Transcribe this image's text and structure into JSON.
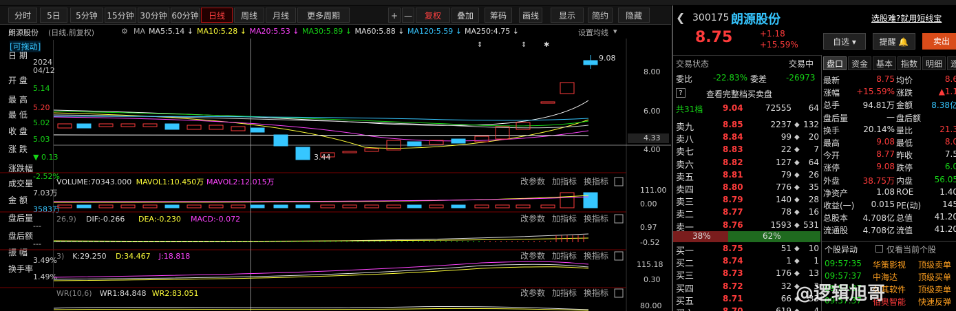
{
  "toolbar": {
    "buttons": [
      "分时",
      "5日",
      "5分钟",
      "15分钟",
      "30分钟",
      "60分钟",
      "日线",
      "周线",
      "月线",
      "更多周期",
      "+",
      "—",
      "复权",
      "叠加",
      "筹码",
      "画线",
      "显示",
      "简约",
      "隐藏"
    ],
    "active": "日线"
  },
  "chart_head": {
    "stock": "朗源股份",
    "mode": "(日线,前复权)",
    "ma": [
      {
        "t": "MA5:5.14",
        "c": "#e0e0e0"
      },
      {
        "t": "MA10:5.28",
        "c": "#ffff3a"
      },
      {
        "t": "MA20:5.53",
        "c": "#ff44ff"
      },
      {
        "t": "MA30:5.89",
        "c": "#16d416"
      },
      {
        "t": "MA60:5.88",
        "c": "#e0e0e0"
      },
      {
        "t": "MA120:5.59",
        "c": "#36c6ff"
      },
      {
        "t": "MA250:4.75",
        "c": "#e0e0e0"
      }
    ],
    "set_label": "设置均线"
  },
  "info": {
    "drag": "[可拖动]",
    "rows": [
      {
        "k": "日  期",
        "v": "2024",
        "v2": "04/12",
        "c": "#ccc"
      },
      {
        "k": "开  盘",
        "v": "5.14",
        "c": "#16d416"
      },
      {
        "k": "最  高",
        "v": "5.20",
        "c": "#ff3b3b"
      },
      {
        "k": "最  低",
        "v": "5.02",
        "c": "#16d416"
      },
      {
        "k": "收  盘",
        "v": "5.03",
        "c": "#16d416"
      },
      {
        "k": "涨  跌",
        "v": "▼ 0.13",
        "c": "#16d416"
      },
      {
        "k": "涨跌幅",
        "v": "-2.52%",
        "c": "#16d416"
      },
      {
        "k": "成交量",
        "v": "7.03万",
        "c": "#ccc"
      },
      {
        "k": "金  额",
        "v": "3583万",
        "c": "#36c6ff"
      },
      {
        "k": "盘后量",
        "v": "---",
        "c": "#ccc"
      },
      {
        "k": "盘后额",
        "v": "---",
        "c": "#ccc"
      },
      {
        "k": "振  幅",
        "v": "3.49%",
        "c": "#ccc"
      },
      {
        "k": "换手率",
        "v": "1.49%",
        "c": "#ccc"
      }
    ]
  },
  "price_axis": [
    "8.00",
    "6.00",
    "4.33",
    "4.00"
  ],
  "markers": {
    "high": "9.08",
    "low": "3.44"
  },
  "volume": {
    "label": "VOLUME:70343.000",
    "mavol1": "MAVOL1:10.450万",
    "mavol2": "MAVOL2:12.015万",
    "axis": [
      "111.00",
      "0.00"
    ]
  },
  "macd": {
    "prefix": "26,9)",
    "dif": "DIF:-0.266",
    "dea": "DEA:-0.230",
    "macd": "MACD:-0.072",
    "axis": [
      "0.97",
      "-0.52"
    ]
  },
  "kdj": {
    "prefix": "3)",
    "k": "K:29.250",
    "d": "D:34.467",
    "j": "J:18.818",
    "axis": [
      "115.18",
      "0.30"
    ]
  },
  "wr": {
    "prefix": "WR(10,6)",
    "wr1": "WR1:84.848",
    "wr2": "WR2:83.051",
    "axis": [
      "80.00"
    ]
  },
  "sub_tools": [
    "改参数",
    "加指标",
    "换指标"
  ],
  "right": {
    "code": "300175",
    "name": "朗源股份",
    "promo": "选股难?就用短线宝",
    "price": "8.75",
    "change": "+1.18",
    "pct": "+15.59%",
    "btn_fav": "自选",
    "btn_alert": "提醒",
    "btn_sell": "卖出",
    "status_label": "交易状态",
    "status_value": "交易中",
    "weibi_label": "委比",
    "weibi": "-22.83%",
    "weicha_label": "委差",
    "weicha": "-26973",
    "full_book": "查看完整档买卖盘",
    "total_label": "共31档",
    "total_price": "9.04",
    "total_vol": "72555",
    "total_cnt": "64",
    "asks": [
      {
        "l": "卖九",
        "p": "8.85",
        "v": "2237",
        "c": "132"
      },
      {
        "l": "卖八",
        "p": "8.84",
        "v": "99",
        "c": "20"
      },
      {
        "l": "卖七",
        "p": "8.83",
        "v": "22",
        "c": "7"
      },
      {
        "l": "卖六",
        "p": "8.82",
        "v": "127",
        "c": "64"
      },
      {
        "l": "卖五",
        "p": "8.81",
        "v": "79",
        "c": "26"
      },
      {
        "l": "卖四",
        "p": "8.80",
        "v": "776",
        "c": "35"
      },
      {
        "l": "卖三",
        "p": "8.79",
        "v": "140",
        "c": "28"
      },
      {
        "l": "卖二",
        "p": "8.77",
        "v": "78",
        "c": "16"
      },
      {
        "l": "卖一",
        "p": "8.76",
        "v": "1593",
        "c": "531"
      }
    ],
    "ratio_left": "38%",
    "ratio_right": "62%",
    "bids": [
      {
        "l": "买一",
        "p": "8.75",
        "v": "51",
        "c": "10"
      },
      {
        "l": "买二",
        "p": "8.74",
        "v": "1",
        "c": "1"
      },
      {
        "l": "买三",
        "p": "8.73",
        "v": "176",
        "c": "13"
      },
      {
        "l": "买四",
        "p": "8.72",
        "v": "32",
        "c": "3"
      },
      {
        "l": "买五",
        "p": "8.71",
        "v": "66",
        "c": "33"
      },
      {
        "l": "买六",
        "p": "8.70",
        "v": "619",
        "c": "4"
      }
    ],
    "tabs": [
      "盘口",
      "资金",
      "基本",
      "指数",
      "明细",
      "逐笔"
    ],
    "quote": [
      {
        "l": "最新",
        "v": "8.75",
        "vc": "#ff3b3b",
        "l2": "均价",
        "v2": "8.6",
        "v2c": "#ff3b3b"
      },
      {
        "l": "涨幅",
        "v": "+15.59%",
        "vc": "#ff3b3b",
        "l2": "涨跌",
        "v2": "▲1.1",
        "v2c": "#ff3b3b"
      },
      {
        "l": "总手",
        "v": "94.81万",
        "vc": "#e0e0e0",
        "l2": "金额",
        "v2": "8.38亿",
        "v2c": "#36c6ff"
      },
      {
        "l": "盘后量",
        "v": "—",
        "vc": "#e0e0e0",
        "l2": "盘后额",
        "v2": "",
        "v2c": "#e0e0e0"
      },
      {
        "l": "换手",
        "v": "20.14%",
        "vc": "#e0e0e0",
        "l2": "量比",
        "v2": "21.3",
        "v2c": "#ff3b3b"
      },
      {
        "l": "最高",
        "v": "9.08",
        "vc": "#ff3b3b",
        "l2": "最低",
        "v2": "8.0",
        "v2c": "#ff3b3b"
      },
      {
        "l": "今开",
        "v": "8.77",
        "vc": "#ff3b3b",
        "l2": "昨收",
        "v2": "7.5",
        "v2c": "#e0e0e0"
      },
      {
        "l": "涨停",
        "v": "9.08",
        "vc": "#ff3b3b",
        "l2": "跌停",
        "v2": "6.0",
        "v2c": "#16d416"
      },
      {
        "l": "外盘",
        "v": "38.75万",
        "vc": "#ff3b3b",
        "l2": "内盘",
        "v2": "56.05",
        "v2c": "#16d416"
      },
      {
        "l": "净资产",
        "v": "1.08",
        "vc": "#e0e0e0",
        "l2": "ROE",
        "v2": "1.40",
        "v2c": "#e0e0e0"
      },
      {
        "l": "收益(一)",
        "v": "0.015",
        "vc": "#e0e0e0",
        "l2": "PE(动)",
        "v2": "145",
        "v2c": "#e0e0e0"
      },
      {
        "l": "总股本",
        "v": "4.708亿",
        "vc": "#e0e0e0",
        "l2": "总值",
        "v2": "41.20",
        "v2c": "#e0e0e0"
      },
      {
        "l": "流通股",
        "v": "4.708亿",
        "vc": "#e0e0e0",
        "l2": "流值",
        "v2": "41.20",
        "v2c": "#e0e0e0"
      }
    ],
    "anomaly_title": "个股异动",
    "anomaly_check": "仅看当前个股",
    "anomaly": [
      {
        "t": "09:57:35",
        "n": "华策影视",
        "e": "顶级卖单",
        "nc": "#ffa020"
      },
      {
        "t": "09:57:37",
        "n": "中海达",
        "e": "顶级买单",
        "nc": "#ffa020"
      },
      {
        "t": "09:57:37",
        "n": "久其软件",
        "e": "顶级卖单",
        "nc": "#ffa020"
      },
      {
        "t": "09:57:37",
        "n": "佰奥智能",
        "e": "快速反弹",
        "nc": "#ff3b3b"
      }
    ],
    "watermark": "@逻辑旭哥"
  }
}
